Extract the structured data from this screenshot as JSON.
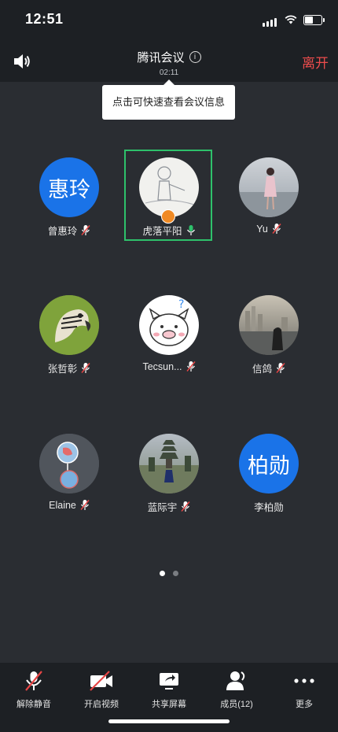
{
  "status": {
    "time": "12:51"
  },
  "header": {
    "title": "腾讯会议",
    "duration": "02:11",
    "leave_label": "离开"
  },
  "tooltip": {
    "text": "点击可快速查看会议信息"
  },
  "participants": [
    {
      "name": "曾惠玲",
      "avatar_text": "惠玲",
      "mic": "muted"
    },
    {
      "name": "虎落平阳",
      "avatar_text": "",
      "mic": "speaking",
      "host": true
    },
    {
      "name": "Yu",
      "avatar_text": "",
      "mic": "muted"
    },
    {
      "name": "张哲彰",
      "avatar_text": "",
      "mic": "muted"
    },
    {
      "name": "Tecsun...",
      "avatar_text": "",
      "mic": "muted"
    },
    {
      "name": "信鸽",
      "avatar_text": "",
      "mic": "muted"
    },
    {
      "name": "Elaine",
      "avatar_text": "",
      "mic": "muted"
    },
    {
      "name": "蓝际宇",
      "avatar_text": "",
      "mic": "muted"
    },
    {
      "name": "李柏勋",
      "avatar_text": "柏勋",
      "mic": "none"
    }
  ],
  "pagination": {
    "pages": 2,
    "current": 1
  },
  "toolbar": {
    "unmute_label": "解除静音",
    "video_label": "开启视频",
    "share_label": "共享屏幕",
    "members_label": "成员(12)",
    "more_label": "更多"
  },
  "colors": {
    "accent_blue": "#1a73e8",
    "leave_red": "#ec4c4c",
    "speaking_green": "#2ec16b"
  }
}
